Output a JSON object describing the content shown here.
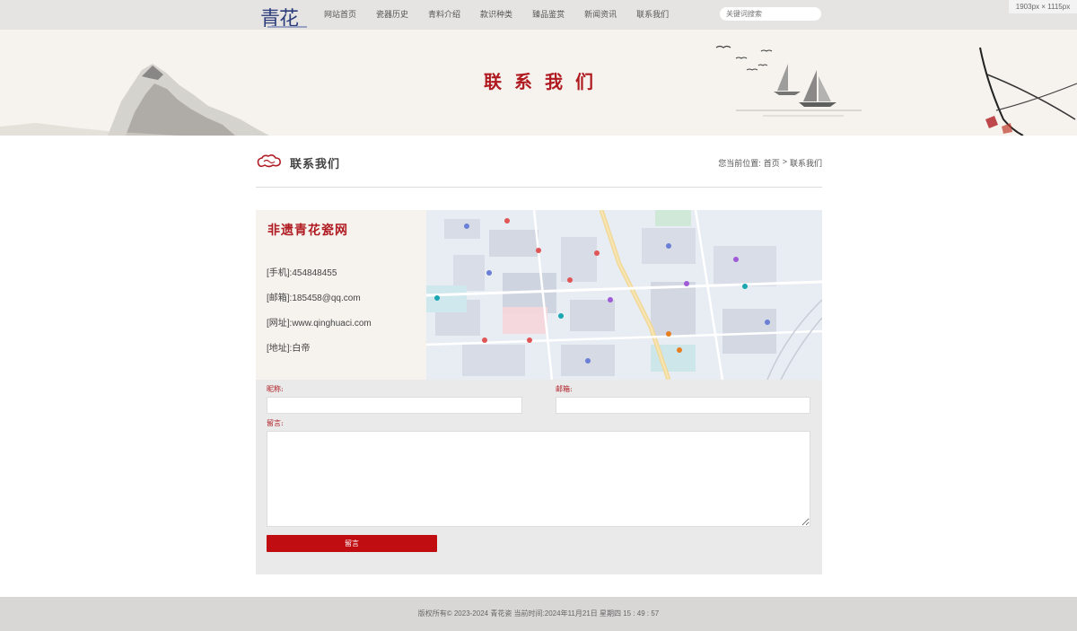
{
  "header": {
    "logo_text": "青花瓷",
    "nav": [
      "网站首页",
      "瓷器历史",
      "青料介绍",
      "款识种类",
      "臻品鉴赏",
      "新闻资讯",
      "联系我们"
    ],
    "search_placeholder": "关键词搜索"
  },
  "dims_overlay": "1903px × 1115px",
  "banner": {
    "title": "联系我们"
  },
  "section": {
    "title": "联系我们",
    "breadcrumb": {
      "prefix": "您当前位置:",
      "home": "首页",
      "sep": ">",
      "current": "联系我们"
    }
  },
  "contact": {
    "site_name": "非遗青花瓷网",
    "phone": "[手机]:454848455",
    "email": "[邮箱]:185458@qq.com",
    "website": "[网址]:www.qinghuaci.com",
    "address": "[地址]:白帝"
  },
  "form": {
    "name_label": "昵称:",
    "email_label": "邮箱:",
    "message_label": "留言:",
    "submit_label": "留言"
  },
  "footer": {
    "text": "版权所有© 2023-2024 青花瓷 当前时间:2024年11月21日 星期四 15 : 49 : 57"
  },
  "colors": {
    "accent": "#b01b22",
    "button": "#c00d12",
    "topbar": "#e6e3e3",
    "footer": "#d9d6d6"
  }
}
